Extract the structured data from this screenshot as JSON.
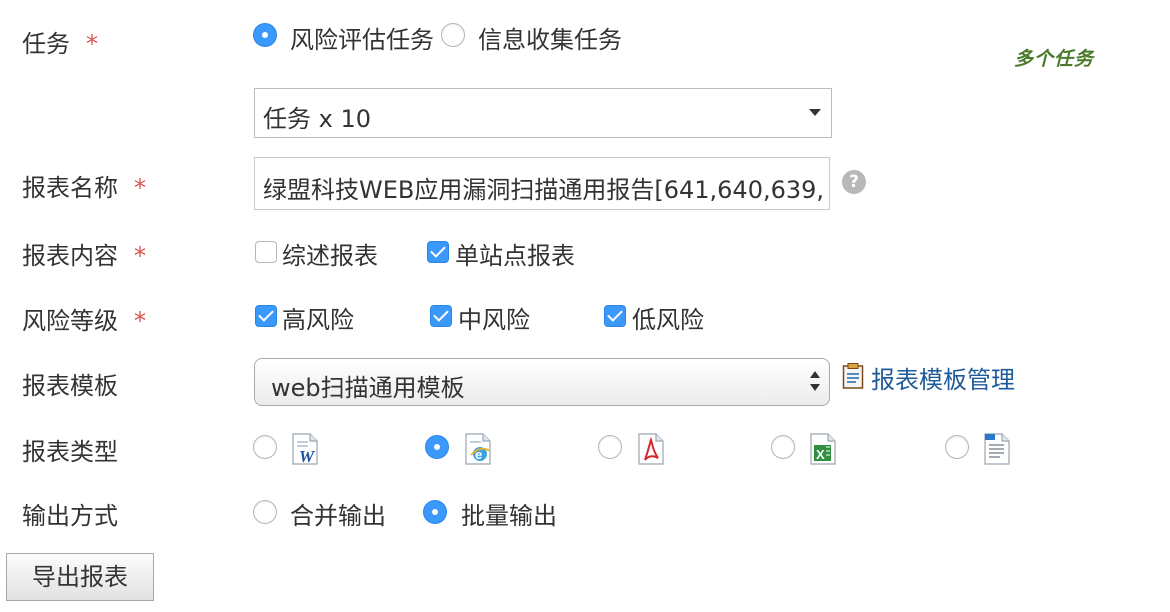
{
  "form": {
    "task": {
      "label": "任务",
      "required_mark": "*",
      "options": [
        "风险评估任务",
        "信息收集任务"
      ],
      "selected_index": 0,
      "annotation": "多个任务",
      "task_select_value": "任务 x 10"
    },
    "report_name": {
      "label": "报表名称",
      "required_mark": "*",
      "value": "绿盟科技WEB应用漏洞扫描通用报告[641,640,639,"
    },
    "report_content": {
      "label": "报表内容",
      "required_mark": "*",
      "options": [
        {
          "label": "综述报表",
          "checked": false
        },
        {
          "label": "单站点报表",
          "checked": true
        }
      ]
    },
    "risk_level": {
      "label": "风险等级",
      "required_mark": "*",
      "options": [
        {
          "label": "高风险",
          "checked": true
        },
        {
          "label": "中风险",
          "checked": true
        },
        {
          "label": "低风险",
          "checked": true
        }
      ]
    },
    "template": {
      "label": "报表模板",
      "value": "web扫描通用模板",
      "manage_link": "报表模板管理"
    },
    "report_type": {
      "label": "报表类型",
      "options": [
        {
          "icon": "word-file-icon",
          "selected": false
        },
        {
          "icon": "html-file-icon",
          "selected": true
        },
        {
          "icon": "pdf-file-icon",
          "selected": false
        },
        {
          "icon": "excel-file-icon",
          "selected": false
        },
        {
          "icon": "xml-file-icon",
          "selected": false
        }
      ]
    },
    "output_mode": {
      "label": "输出方式",
      "options": [
        "合并输出",
        "批量输出"
      ],
      "selected_index": 1
    },
    "export_button": "导出报表"
  },
  "colors": {
    "accent": "#3b99fc",
    "required": "#d9534f",
    "annotation": "#4a7a2a",
    "link": "#1f5b9a"
  }
}
